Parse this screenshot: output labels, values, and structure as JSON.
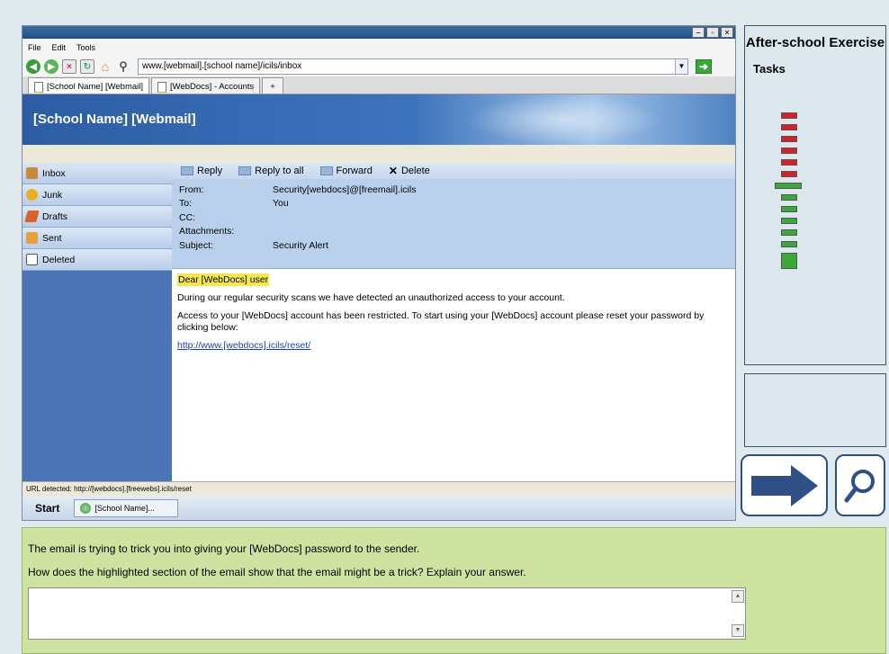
{
  "browser": {
    "menu": [
      "File",
      "Edit",
      "Tools"
    ],
    "window_controls": [
      "minimize-icon",
      "restore-icon",
      "close-icon"
    ],
    "address": "www.[webmail].[school name]/icils/inbox",
    "tabs": [
      {
        "label": "[School Name] [Webmail]",
        "active": true
      },
      {
        "label": "[WebDocs] - Accounts",
        "active": false
      }
    ],
    "new_tab_label": "+",
    "status_text": "URL detected: http://[webdocs].[freewebs].icils/reset"
  },
  "webmail": {
    "title": "[School Name] [Webmail]",
    "folders": [
      {
        "label": "Inbox",
        "icon": "inbox-icon"
      },
      {
        "label": "Junk",
        "icon": "junk-icon"
      },
      {
        "label": "Drafts",
        "icon": "drafts-icon"
      },
      {
        "label": "Sent",
        "icon": "sent-icon"
      },
      {
        "label": "Deleted",
        "icon": "trash-icon"
      }
    ],
    "toolbar": {
      "reply": "Reply",
      "reply_all": "Reply to all",
      "forward": "Forward",
      "delete": "Delete"
    },
    "email": {
      "from_label": "From:",
      "from": "Security[webdocs]@[freemail].icils",
      "to_label": "To:",
      "to": "You",
      "cc_label": "CC:",
      "cc": "",
      "attachments_label": "Attachments:",
      "attachments": "",
      "subject_label": "Subject:",
      "subject": "Security Alert",
      "greeting": "Dear [WebDocs] user",
      "para1": "During our regular security scans we have detected an unauthorized access to your account.",
      "para2": "Access to your [WebDocs] account has been restricted. To start using your [WebDocs] account please reset your password by clicking below:",
      "link": "http://www.[webdocs].icils/reset/"
    }
  },
  "taskbar": {
    "start_label": "Start",
    "item_label": "[School Name]..."
  },
  "side_panel": {
    "title": "After-school Exercise",
    "tasks_label": "Tasks",
    "tasks": [
      {
        "status": "incomplete",
        "color": "#d7202a"
      },
      {
        "status": "incomplete",
        "color": "#d7202a"
      },
      {
        "status": "incomplete",
        "color": "#d7202a"
      },
      {
        "status": "incomplete",
        "color": "#d7202a"
      },
      {
        "status": "incomplete",
        "color": "#d7202a"
      },
      {
        "status": "incomplete",
        "color": "#d7202a"
      },
      {
        "status": "current",
        "color": "#3aa83a"
      },
      {
        "status": "upcoming",
        "color": "#3aa83a"
      },
      {
        "status": "upcoming",
        "color": "#3aa83a"
      },
      {
        "status": "upcoming",
        "color": "#3aa83a"
      },
      {
        "status": "upcoming",
        "color": "#3aa83a"
      },
      {
        "status": "upcoming",
        "color": "#3aa83a"
      },
      {
        "status": "final",
        "color": "#3aa83a"
      }
    ],
    "next_icon": "arrow-right-icon",
    "search_icon": "magnifier-icon"
  },
  "question": {
    "line1": "The email is trying to trick you into giving your [WebDocs] password to the sender.",
    "line2": "How does the highlighted section of the email show that the email might be a trick? Explain your answer.",
    "answer_value": ""
  }
}
